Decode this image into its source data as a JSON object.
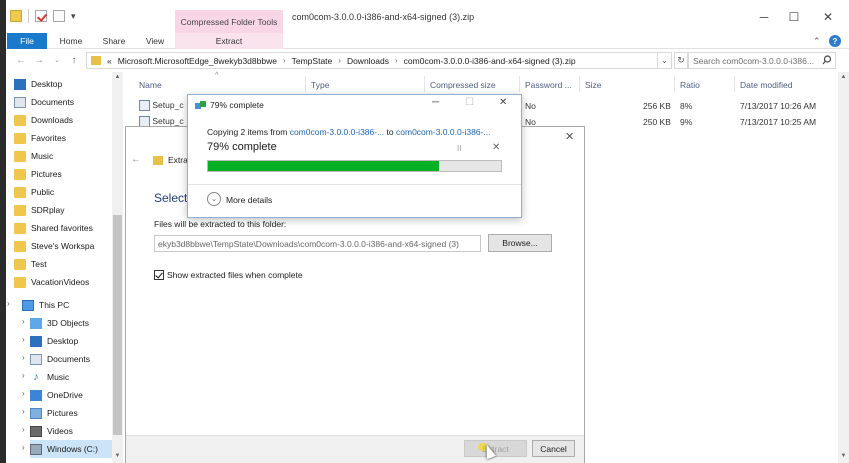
{
  "window": {
    "context_tab": "Compressed Folder Tools",
    "title": "com0com-3.0.0.0-i386-and-x64-signed (3).zip",
    "controls": {
      "minimize": "─",
      "maximize": "☐",
      "close": "✕"
    }
  },
  "ribbon": {
    "tabs": [
      "File",
      "Home",
      "Share",
      "View",
      "Extract"
    ],
    "help": "?"
  },
  "address": {
    "prefix": "«",
    "crumbs": [
      "Microsoft.MicrosoftEdge_8wekyb3d8bbwe",
      "TempState",
      "Downloads",
      "com0com-3.0.0.0-i386-and-x64-signed (3).zip"
    ],
    "separator": "›",
    "search_placeholder": "Search com0com-3.0.0.0-i386..."
  },
  "nav": {
    "quick_access": [
      {
        "label": "Desktop",
        "icon": "desktop-icon"
      },
      {
        "label": "Documents",
        "icon": "documents-icon"
      },
      {
        "label": "Downloads",
        "icon": "downloads-icon"
      },
      {
        "label": "Favorites",
        "icon": "folder-icon"
      },
      {
        "label": "Music",
        "icon": "folder-icon"
      },
      {
        "label": "Pictures",
        "icon": "folder-icon"
      },
      {
        "label": "Public",
        "icon": "folder-icon"
      },
      {
        "label": "SDRplay",
        "icon": "folder-icon"
      },
      {
        "label": "Shared favorites",
        "icon": "folder-icon"
      },
      {
        "label": "Steve's Workspa",
        "icon": "folder-icon"
      },
      {
        "label": "Test",
        "icon": "folder-icon"
      },
      {
        "label": "VacationVideos",
        "icon": "folder-icon"
      }
    ],
    "this_pc": "This PC",
    "pc_items": [
      {
        "label": "3D Objects",
        "icon": "3d-objects-icon"
      },
      {
        "label": "Desktop",
        "icon": "desktop-icon"
      },
      {
        "label": "Documents",
        "icon": "documents-icon"
      },
      {
        "label": "Music",
        "icon": "music-icon"
      },
      {
        "label": "OneDrive",
        "icon": "onedrive-icon"
      },
      {
        "label": "Pictures",
        "icon": "pictures-icon"
      },
      {
        "label": "Videos",
        "icon": "videos-icon"
      },
      {
        "label": "Windows (C:)",
        "icon": "drive-icon"
      }
    ]
  },
  "columns": [
    "Name",
    "Type",
    "Compressed size",
    "Password ...",
    "Size",
    "Ratio",
    "Date modified"
  ],
  "rows": [
    {
      "name": "Setup_c",
      "password": "No",
      "size": "256 KB",
      "ratio": "8%",
      "date": "7/13/2017 10:26 AM"
    },
    {
      "name": "Setup_c",
      "password": "No",
      "size": "250 KB",
      "ratio": "9%",
      "date": "7/13/2017 10:25 AM"
    }
  ],
  "wizard": {
    "title": "Extra",
    "heading": "Select",
    "path_label": "Files will be extracted to this folder:",
    "path_value": "ekyb3d8bbwe\\TempState\\Downloads\\com0com-3.0.0.0-i386-and-x64-signed (3)",
    "browse": "Browse...",
    "show_files": "Show extracted files when complete",
    "show_files_checked": true,
    "extract": "Extract",
    "cancel": "Cancel"
  },
  "progress": {
    "title": "79% complete",
    "copy_prefix": "Copying 2 items from",
    "source": "com0com-3.0.0.0-i386-...",
    "to": "to",
    "dest": "com0com-3.0.0.0-i386-...",
    "status": "79% complete",
    "percent": 79,
    "pause": "II",
    "stop": "✕",
    "more_details": "More details",
    "bar_color": "#06b025"
  }
}
